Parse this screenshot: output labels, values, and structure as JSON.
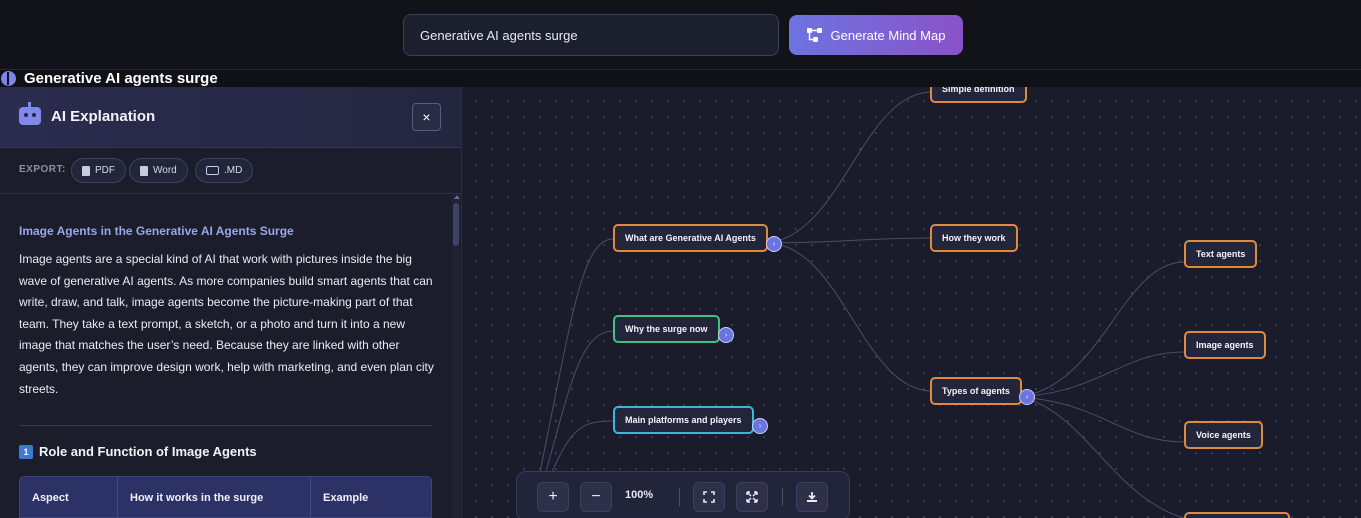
{
  "search": {
    "value": "Generative AI agents surge"
  },
  "generate_button": {
    "label": "Generate Mind Map"
  },
  "page_title": "Generative AI agents surge",
  "panel": {
    "title": "AI Explanation",
    "close_label": "×",
    "export_label": "EXPORT:",
    "export_buttons": [
      "PDF",
      "Word",
      ".MD"
    ],
    "section_title": "Image Agents in the Generative AI Agents Surge",
    "paragraph": "Image agents are a special kind of AI that work with pictures inside the big wave of generative AI agents. As more companies build smart agents that can write, draw, and talk, image agents become the picture-making part of that team. They take a text prompt, a sketch, or a photo and turn it into a new image that matches the user’s need. Because they are linked with other agents, they can improve design work, help with marketing, and even plan city streets.",
    "heading2_number": "1",
    "heading2": "Role and Function of Image Agents",
    "table_headers": [
      "Aspect",
      "How it works in the surge",
      "Example"
    ]
  },
  "mindmap": {
    "nodes": {
      "simple_definition": "Simple definition",
      "what_are": "What are Generative AI Agents",
      "how_they_work": "How they work",
      "why_surge": "Why the surge now",
      "main_platforms": "Main platforms and players",
      "types_of_agents": "Types of agents",
      "text_agents": "Text agents",
      "image_agents": "Image agents",
      "voice_agents": "Voice agents"
    },
    "toggles": {
      "collapse": "‹",
      "expand": "›"
    }
  },
  "zoom": {
    "in": "+",
    "out": "−",
    "level": "100%"
  },
  "colors": {
    "accent": "#6c74e0",
    "node_orange": "#e08a3c",
    "node_green": "#46c07a",
    "node_cyan": "#3cb8d6"
  }
}
